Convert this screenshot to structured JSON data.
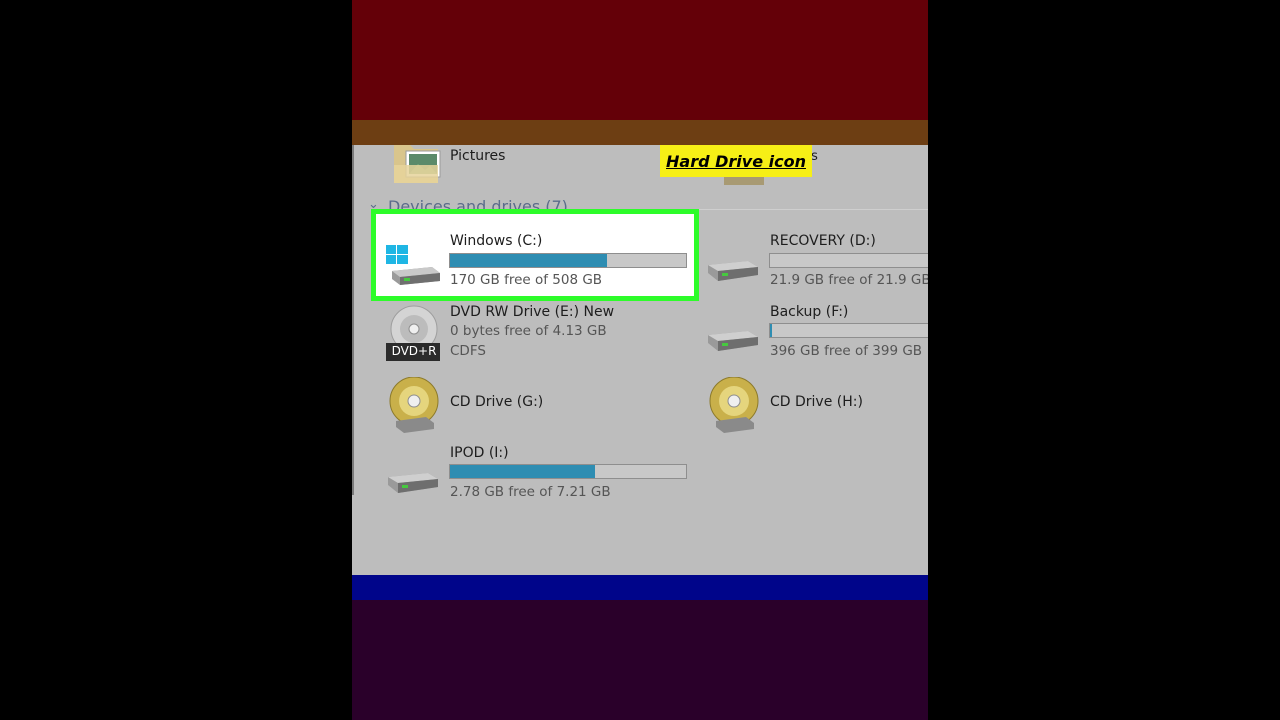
{
  "callout": {
    "text": "Hard Drive icon",
    "color": "#f6ef16"
  },
  "folders": [
    {
      "label": "Pictures"
    },
    {
      "label_fragment": "cos"
    }
  ],
  "section": {
    "title": "Devices and drives (7)"
  },
  "drives": [
    {
      "name": "Windows (C:)",
      "free": "170 GB free of 508 GB",
      "used_fraction": 0.665,
      "highlighted": true,
      "icon": "windows-hard-drive-icon"
    },
    {
      "name": "RECOVERY (D:)",
      "free": "21.9 GB free of 21.9 GB",
      "used_fraction": 0.0,
      "icon": "hard-drive-icon"
    },
    {
      "name": "DVD RW Drive (E:) New",
      "free": "0 bytes free of 4.13 GB",
      "filesystem": "CDFS",
      "badge": "DVD+R",
      "icon": "dvd-icon"
    },
    {
      "name": "Backup (F:)",
      "free": "396 GB free of 399 GB",
      "used_fraction": 0.01,
      "icon": "hard-drive-icon"
    },
    {
      "name": "CD Drive (G:)",
      "icon": "cd-drive-icon"
    },
    {
      "name": "CD Drive (H:)",
      "icon": "cd-drive-icon"
    },
    {
      "name": "IPOD (I:)",
      "free": "2.78 GB free of 7.21 GB",
      "used_fraction": 0.615,
      "icon": "hard-drive-icon"
    }
  ],
  "colors": {
    "highlight": "#2dfc2a",
    "bar_fill": "#2e8db2",
    "band_top": "#640008",
    "band_bottom": "#2a002a",
    "band_blue": "#00058a"
  }
}
